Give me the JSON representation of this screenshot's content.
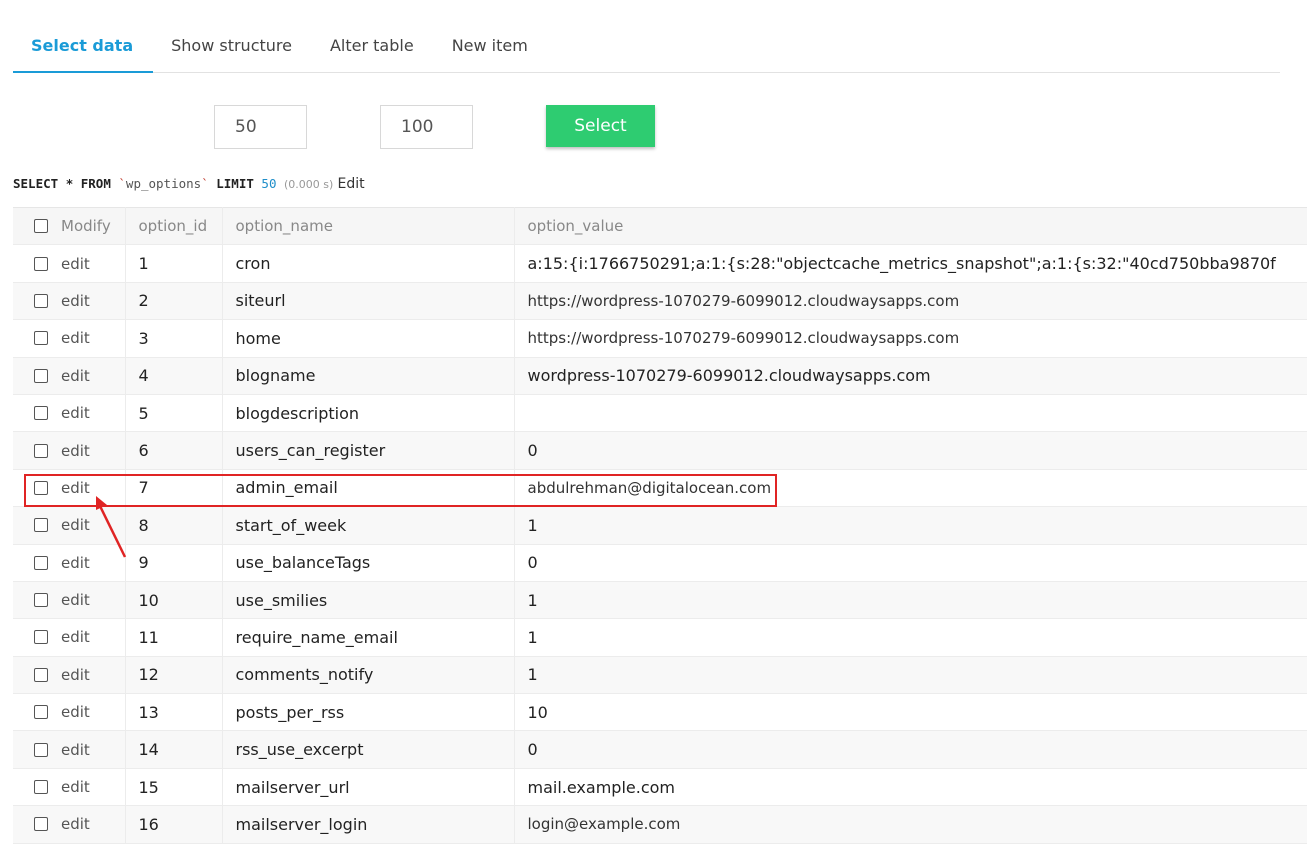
{
  "tabs": [
    {
      "label": "Select data",
      "active": true
    },
    {
      "label": "Show structure",
      "active": false
    },
    {
      "label": "Alter table",
      "active": false
    },
    {
      "label": "New item",
      "active": false
    }
  ],
  "controls": {
    "limit_value": "50",
    "text_length_value": "100",
    "select_label": "Select"
  },
  "sql": {
    "select": "SELECT",
    "star": "*",
    "from": "FROM",
    "tick": "`",
    "table": "wp_options",
    "limit_kw": "LIMIT",
    "limit": "50",
    "time": "(0.000 s)",
    "edit": "Edit"
  },
  "table": {
    "headers": [
      "Modify",
      "option_id",
      "option_name",
      "option_value"
    ],
    "edit_label": "edit",
    "rows": [
      {
        "id": "1",
        "name": "cron",
        "value": "a:15:{i:1766750291;a:1:{s:28:\"objectcache_metrics_snapshot\";a:1:{s:32:\"40cd750bba9870f"
      },
      {
        "id": "2",
        "name": "siteurl",
        "value": "https://wordpress-1070279-6099012.cloudwaysapps.com"
      },
      {
        "id": "3",
        "name": "home",
        "value": "https://wordpress-1070279-6099012.cloudwaysapps.com"
      },
      {
        "id": "4",
        "name": "blogname",
        "value": "wordpress-1070279-6099012.cloudwaysapps.com"
      },
      {
        "id": "5",
        "name": "blogdescription",
        "value": ""
      },
      {
        "id": "6",
        "name": "users_can_register",
        "value": "0"
      },
      {
        "id": "7",
        "name": "admin_email",
        "value": "abdulrehman@digitalocean.com"
      },
      {
        "id": "8",
        "name": "start_of_week",
        "value": "1"
      },
      {
        "id": "9",
        "name": "use_balanceTags",
        "value": "0"
      },
      {
        "id": "10",
        "name": "use_smilies",
        "value": "1"
      },
      {
        "id": "11",
        "name": "require_name_email",
        "value": "1"
      },
      {
        "id": "12",
        "name": "comments_notify",
        "value": "1"
      },
      {
        "id": "13",
        "name": "posts_per_rss",
        "value": "10"
      },
      {
        "id": "14",
        "name": "rss_use_excerpt",
        "value": "0"
      },
      {
        "id": "15",
        "name": "mailserver_url",
        "value": "mail.example.com"
      },
      {
        "id": "16",
        "name": "mailserver_login",
        "value": "login@example.com"
      }
    ]
  },
  "colors": {
    "accent": "#1a9bd7",
    "button": "#2ecc71",
    "annotation": "#e02424"
  }
}
